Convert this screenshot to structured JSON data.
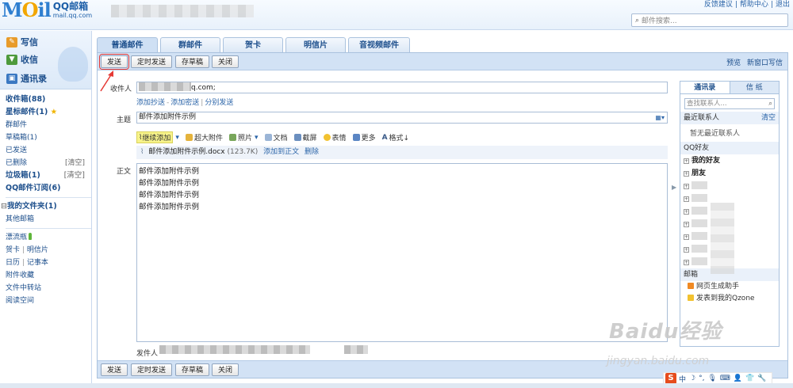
{
  "header": {
    "logo_mail": "MOil",
    "logo_cn": "QQ邮箱",
    "logo_url": "mail.qq.com",
    "top_links": [
      "反馈建议",
      "|",
      "帮助中心",
      "|",
      "退出"
    ],
    "search_placeholder": "邮件搜索..."
  },
  "sidebar": {
    "actions": [
      {
        "label": "写信",
        "icon": "pencil-icon"
      },
      {
        "label": "收信",
        "icon": "inbox-icon"
      },
      {
        "label": "通讯录",
        "icon": "contacts-icon"
      }
    ],
    "folders": [
      {
        "label": "收件箱(88)",
        "bold": true
      },
      {
        "label": "星标邮件(1)",
        "bold": true,
        "star": true
      },
      {
        "label": "群邮件"
      },
      {
        "label": "草稿箱(1)"
      },
      {
        "label": "已发送"
      },
      {
        "label": "已删除",
        "clear": "[清空]"
      },
      {
        "label": "垃圾箱(1)",
        "bold": true,
        "clear": "[清空]"
      },
      {
        "label": "QQ邮件订阅(6)",
        "bold": true
      }
    ],
    "my_folders": "我的文件夹(1)",
    "other_mail": "其他邮箱",
    "extras": {
      "drift_bottle": "漂流瓶",
      "card": "贺卡",
      "postcard": "明信片",
      "calendar": "日历",
      "notes": "记事本",
      "attachments": "附件收藏",
      "file_transfer": "文件中转站",
      "reading": "阅读空间"
    },
    "divider": "|"
  },
  "tabs": [
    "普通邮件",
    "群邮件",
    "贺卡",
    "明信片",
    "音视频邮件"
  ],
  "toolbar": {
    "send": "发送",
    "schedule": "定时发送",
    "save_draft": "存草稿",
    "close": "关闭",
    "preview": "预览",
    "new_window": "新窗口写信"
  },
  "compose": {
    "to_label": "收件人",
    "to_value": "q.com;",
    "add_cc": "添加抄送",
    "add_bcc": "添加密送",
    "separate_send": "分别发送",
    "link_sep": "-",
    "link_bar": "|",
    "subject_label": "主题",
    "subject_value": "邮件添加附件示例",
    "body_label": "正文",
    "sender_label": "发件人",
    "format_tools": [
      {
        "label": "继续添加",
        "icon": "paperclip-icon"
      },
      {
        "label": "超大附件",
        "icon": "large-attachment-icon"
      },
      {
        "label": "照片",
        "icon": "photo-icon"
      },
      {
        "label": "文档",
        "icon": "document-icon"
      },
      {
        "label": "截屏",
        "icon": "screenshot-icon"
      },
      {
        "label": "表情",
        "icon": "emoji-icon"
      },
      {
        "label": "更多",
        "icon": "more-icon"
      },
      {
        "label": "格式↓",
        "icon": "format-icon"
      }
    ],
    "attachment": {
      "name": "邮件添加附件示例.docx",
      "size": "(123.7K)",
      "add_to_body": "添加到正文",
      "delete": "删除"
    },
    "body_lines": [
      "邮件添加附件示例",
      "邮件添加附件示例",
      "邮件添加附件示例",
      "邮件添加附件示例"
    ]
  },
  "contacts": {
    "tabs": [
      "通讯录",
      "信 纸"
    ],
    "search_placeholder": "查找联系人...",
    "recent": "最近联系人",
    "clear": "清空",
    "no_recent": "暂无最近联系人",
    "qq_friends": "QQ好友",
    "groups": [
      "我的好友",
      "朋友",
      "",
      "",
      "",
      "",
      "",
      "",
      ""
    ],
    "mailbox": "邮箱",
    "mailbox_items": [
      "网页生成助手",
      "发表到我的Qzone"
    ]
  },
  "watermark": {
    "text": "Baidu经验",
    "url": "jingyan.baidu.com"
  },
  "ime": {
    "logo": "S",
    "lang": "中"
  },
  "colors": {
    "accent": "#2a64a8",
    "toolbar": "#d2e2f5",
    "highlight": "#e53935"
  }
}
